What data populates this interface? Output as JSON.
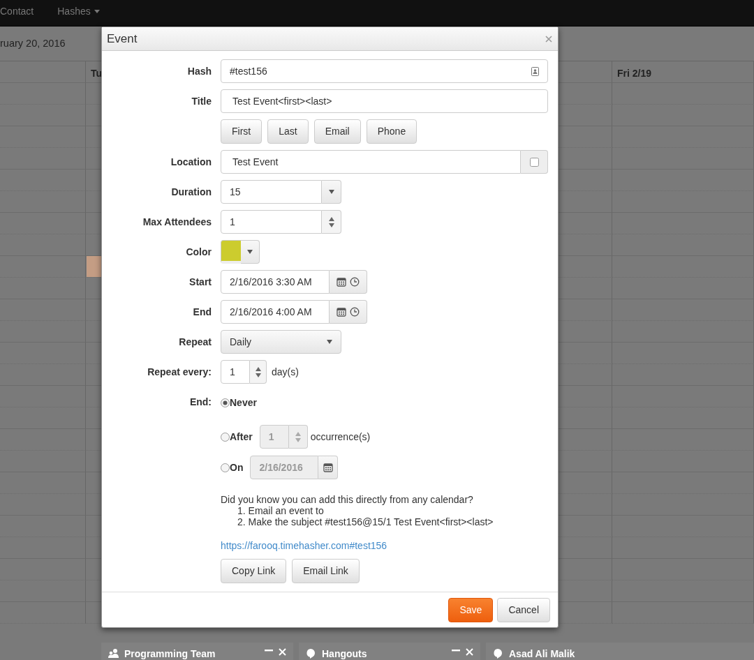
{
  "navbar": {
    "items": [
      {
        "label": "Contact",
        "dropdown": false
      },
      {
        "label": "Hashes",
        "dropdown": true
      }
    ]
  },
  "calendar": {
    "title": "ruary 20, 2016",
    "day_headers": [
      "Tu",
      "Fri 2/19"
    ]
  },
  "modal": {
    "title": "Event",
    "fields": [
      {
        "kind": "hash",
        "label": "Hash",
        "value": "#test156"
      },
      {
        "kind": "title",
        "label": "Title",
        "value": "Test Event<first><last>",
        "insert_buttons": [
          "First",
          "Last",
          "Email",
          "Phone"
        ]
      },
      {
        "kind": "location",
        "label": "Location",
        "value": "Test Event",
        "checked": false
      },
      {
        "kind": "select",
        "label": "Duration",
        "value": "15"
      },
      {
        "kind": "spinner",
        "label": "Max Attendees",
        "value": "1"
      },
      {
        "kind": "color",
        "label": "Color",
        "color": "#cccc2e"
      },
      {
        "kind": "datetime",
        "label": "Start",
        "value": "2/16/2016 3:30 AM"
      },
      {
        "kind": "datetime",
        "label": "End",
        "value": "2/16/2016 4:00 AM"
      },
      {
        "kind": "dropdown",
        "label": "Repeat",
        "value": "Daily"
      },
      {
        "kind": "repeat",
        "label": "Repeat every:",
        "value": "1",
        "unit": "day(s)"
      },
      {
        "kind": "end",
        "label": "End:",
        "options": [
          {
            "kind": "never",
            "label": "Never",
            "selected": true
          },
          {
            "kind": "after",
            "label": "After",
            "selected": false,
            "disabled": true,
            "value": "1",
            "unit": "occurrence(s)"
          },
          {
            "kind": "on",
            "label": "On",
            "selected": false,
            "disabled": true,
            "value": "2/16/2016"
          }
        ]
      }
    ],
    "info": {
      "text": "Did you know you can add this directly from any calendar?",
      "steps": [
        "1. Email an event to",
        "2. Make the subject #test156@15/1 Test Event<first><last>"
      ]
    },
    "link": "https://farooq.timehasher.com#test156",
    "link_buttons": [
      "Copy Link",
      "Email Link"
    ],
    "footer_buttons": [
      {
        "kind": "primary",
        "label": "Save"
      },
      {
        "kind": "default",
        "label": "Cancel"
      }
    ]
  },
  "chats": [
    {
      "kind": "group",
      "title": "Programming Team",
      "window_controls": true
    },
    {
      "kind": "single",
      "title": "Hangouts",
      "window_controls": true
    },
    {
      "kind": "single",
      "title": "Asad Ali Malik",
      "window_controls": false
    }
  ]
}
